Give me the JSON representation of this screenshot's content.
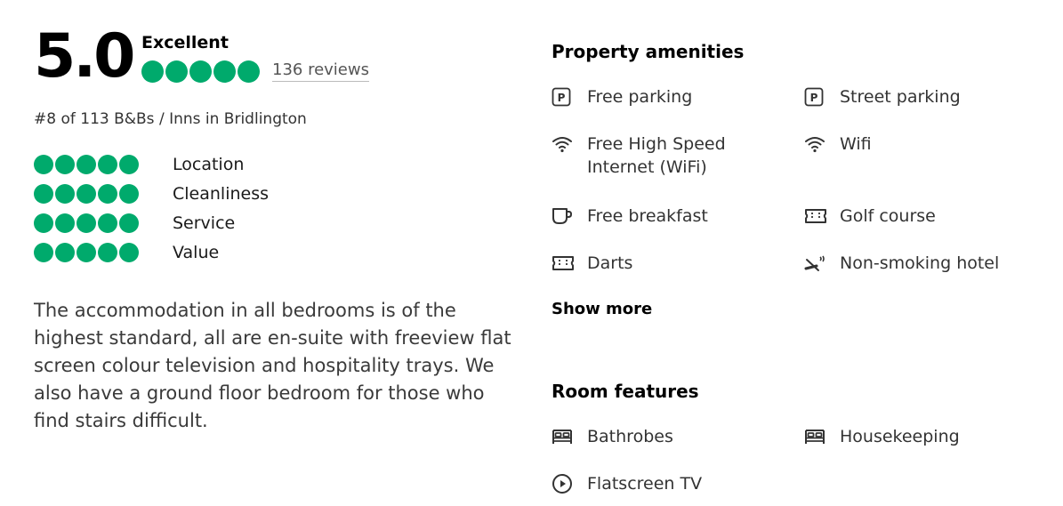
{
  "rating": {
    "score": "5.0",
    "label": "Excellent",
    "bubbles": 5,
    "reviews": "136 reviews",
    "rank": "#8 of 113 B&Bs / Inns in Bridlington"
  },
  "subratings": [
    {
      "label": "Location",
      "bubbles": 5
    },
    {
      "label": "Cleanliness",
      "bubbles": 5
    },
    {
      "label": "Service",
      "bubbles": 5
    },
    {
      "label": "Value",
      "bubbles": 5
    }
  ],
  "description": "The accommodation in all bedrooms is of the highest standard, all are en-suite with freeview flat screen colour television and hospitality trays. We also have a ground floor bedroom for those who find stairs difficult.",
  "amenities": {
    "title": "Property amenities",
    "items": [
      {
        "label": "Free parking",
        "icon": "parking-icon"
      },
      {
        "label": "Street parking",
        "icon": "parking-icon"
      },
      {
        "label": "Free High Speed",
        "label2": "Internet (WiFi)",
        "icon": "wifi-icon"
      },
      {
        "label": "Wifi",
        "icon": "wifi-icon"
      },
      {
        "label": "Free breakfast",
        "icon": "coffee-cup-icon"
      },
      {
        "label": "Golf course",
        "icon": "ticket-icon"
      },
      {
        "label": "Darts",
        "icon": "ticket-icon"
      },
      {
        "label": "Non-smoking hotel",
        "icon": "no-smoking-icon"
      }
    ],
    "show_more": "Show more"
  },
  "room_features": {
    "title": "Room features",
    "items": [
      {
        "label": "Bathrobes",
        "icon": "bed-icon"
      },
      {
        "label": "Housekeeping",
        "icon": "bed-icon"
      },
      {
        "label": "Flatscreen TV",
        "icon": "play-icon"
      }
    ]
  },
  "colors": {
    "bubble": "#00aa6c"
  }
}
